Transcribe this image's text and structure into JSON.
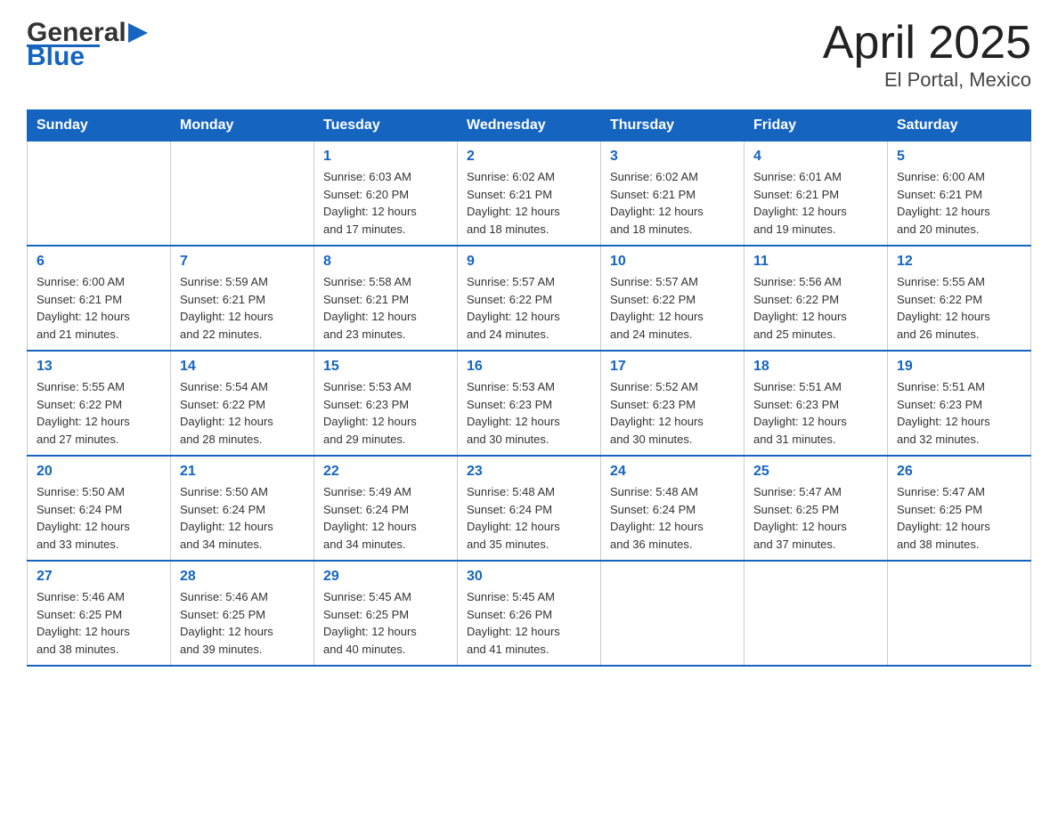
{
  "logo": {
    "text_general": "General",
    "text_blue": "Blue"
  },
  "title": "April 2025",
  "subtitle": "El Portal, Mexico",
  "days_of_week": [
    "Sunday",
    "Monday",
    "Tuesday",
    "Wednesday",
    "Thursday",
    "Friday",
    "Saturday"
  ],
  "weeks": [
    [
      {
        "day": "",
        "info": ""
      },
      {
        "day": "",
        "info": ""
      },
      {
        "day": "1",
        "info": "Sunrise: 6:03 AM\nSunset: 6:20 PM\nDaylight: 12 hours\nand 17 minutes."
      },
      {
        "day": "2",
        "info": "Sunrise: 6:02 AM\nSunset: 6:21 PM\nDaylight: 12 hours\nand 18 minutes."
      },
      {
        "day": "3",
        "info": "Sunrise: 6:02 AM\nSunset: 6:21 PM\nDaylight: 12 hours\nand 18 minutes."
      },
      {
        "day": "4",
        "info": "Sunrise: 6:01 AM\nSunset: 6:21 PM\nDaylight: 12 hours\nand 19 minutes."
      },
      {
        "day": "5",
        "info": "Sunrise: 6:00 AM\nSunset: 6:21 PM\nDaylight: 12 hours\nand 20 minutes."
      }
    ],
    [
      {
        "day": "6",
        "info": "Sunrise: 6:00 AM\nSunset: 6:21 PM\nDaylight: 12 hours\nand 21 minutes."
      },
      {
        "day": "7",
        "info": "Sunrise: 5:59 AM\nSunset: 6:21 PM\nDaylight: 12 hours\nand 22 minutes."
      },
      {
        "day": "8",
        "info": "Sunrise: 5:58 AM\nSunset: 6:21 PM\nDaylight: 12 hours\nand 23 minutes."
      },
      {
        "day": "9",
        "info": "Sunrise: 5:57 AM\nSunset: 6:22 PM\nDaylight: 12 hours\nand 24 minutes."
      },
      {
        "day": "10",
        "info": "Sunrise: 5:57 AM\nSunset: 6:22 PM\nDaylight: 12 hours\nand 24 minutes."
      },
      {
        "day": "11",
        "info": "Sunrise: 5:56 AM\nSunset: 6:22 PM\nDaylight: 12 hours\nand 25 minutes."
      },
      {
        "day": "12",
        "info": "Sunrise: 5:55 AM\nSunset: 6:22 PM\nDaylight: 12 hours\nand 26 minutes."
      }
    ],
    [
      {
        "day": "13",
        "info": "Sunrise: 5:55 AM\nSunset: 6:22 PM\nDaylight: 12 hours\nand 27 minutes."
      },
      {
        "day": "14",
        "info": "Sunrise: 5:54 AM\nSunset: 6:22 PM\nDaylight: 12 hours\nand 28 minutes."
      },
      {
        "day": "15",
        "info": "Sunrise: 5:53 AM\nSunset: 6:23 PM\nDaylight: 12 hours\nand 29 minutes."
      },
      {
        "day": "16",
        "info": "Sunrise: 5:53 AM\nSunset: 6:23 PM\nDaylight: 12 hours\nand 30 minutes."
      },
      {
        "day": "17",
        "info": "Sunrise: 5:52 AM\nSunset: 6:23 PM\nDaylight: 12 hours\nand 30 minutes."
      },
      {
        "day": "18",
        "info": "Sunrise: 5:51 AM\nSunset: 6:23 PM\nDaylight: 12 hours\nand 31 minutes."
      },
      {
        "day": "19",
        "info": "Sunrise: 5:51 AM\nSunset: 6:23 PM\nDaylight: 12 hours\nand 32 minutes."
      }
    ],
    [
      {
        "day": "20",
        "info": "Sunrise: 5:50 AM\nSunset: 6:24 PM\nDaylight: 12 hours\nand 33 minutes."
      },
      {
        "day": "21",
        "info": "Sunrise: 5:50 AM\nSunset: 6:24 PM\nDaylight: 12 hours\nand 34 minutes."
      },
      {
        "day": "22",
        "info": "Sunrise: 5:49 AM\nSunset: 6:24 PM\nDaylight: 12 hours\nand 34 minutes."
      },
      {
        "day": "23",
        "info": "Sunrise: 5:48 AM\nSunset: 6:24 PM\nDaylight: 12 hours\nand 35 minutes."
      },
      {
        "day": "24",
        "info": "Sunrise: 5:48 AM\nSunset: 6:24 PM\nDaylight: 12 hours\nand 36 minutes."
      },
      {
        "day": "25",
        "info": "Sunrise: 5:47 AM\nSunset: 6:25 PM\nDaylight: 12 hours\nand 37 minutes."
      },
      {
        "day": "26",
        "info": "Sunrise: 5:47 AM\nSunset: 6:25 PM\nDaylight: 12 hours\nand 38 minutes."
      }
    ],
    [
      {
        "day": "27",
        "info": "Sunrise: 5:46 AM\nSunset: 6:25 PM\nDaylight: 12 hours\nand 38 minutes."
      },
      {
        "day": "28",
        "info": "Sunrise: 5:46 AM\nSunset: 6:25 PM\nDaylight: 12 hours\nand 39 minutes."
      },
      {
        "day": "29",
        "info": "Sunrise: 5:45 AM\nSunset: 6:25 PM\nDaylight: 12 hours\nand 40 minutes."
      },
      {
        "day": "30",
        "info": "Sunrise: 5:45 AM\nSunset: 6:26 PM\nDaylight: 12 hours\nand 41 minutes."
      },
      {
        "day": "",
        "info": ""
      },
      {
        "day": "",
        "info": ""
      },
      {
        "day": "",
        "info": ""
      }
    ]
  ]
}
